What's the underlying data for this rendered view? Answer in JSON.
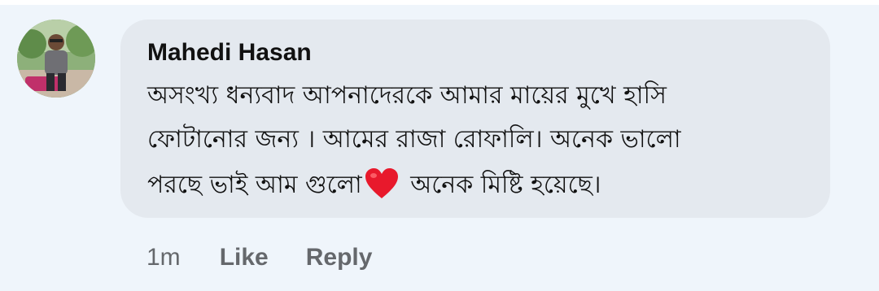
{
  "comment": {
    "author": "Mahedi Hasan",
    "lines": [
      "অসংখ্য ধন্যবাদ আপনাদেরকে আমার মায়ের মুখে হাসি",
      "ফোটানোর জন্য । আমের রাজা রোফালি। অনেক ভালো",
      "পরছে ভাই আম গুলো",
      " অনেক মিষ্টি  হয়েছে।"
    ],
    "emoji": "red-heart"
  },
  "actions": {
    "time": "1m",
    "like_label": "Like",
    "reply_label": "Reply"
  },
  "colors": {
    "background": "#eff5fb",
    "bubble": "#e4e9ef",
    "text": "#111111",
    "meta": "#65686c",
    "heart": "#e8192c"
  }
}
